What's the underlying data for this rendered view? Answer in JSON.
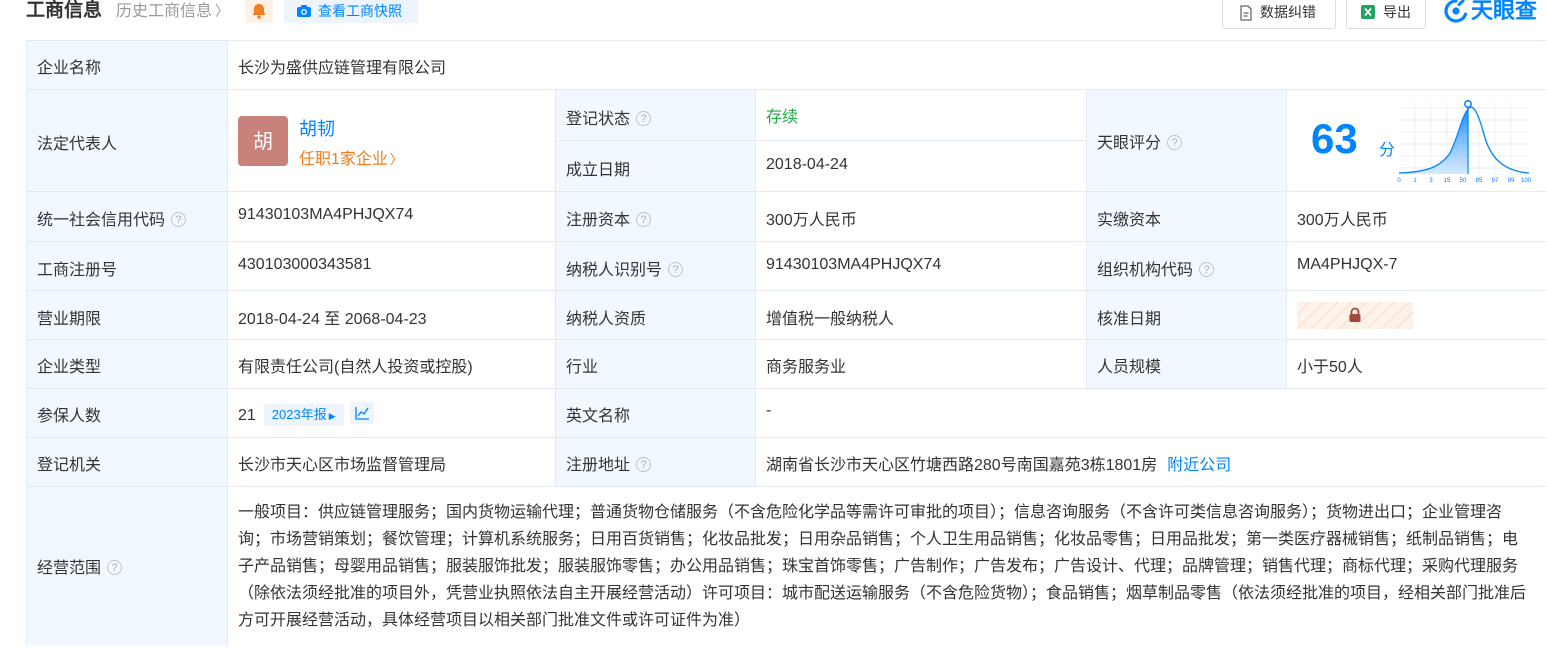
{
  "header": {
    "title": "工商信息",
    "history": "历史工商信息",
    "snapshot": "查看工商快照",
    "fix_btn": "数据纠错",
    "export_btn": "导出",
    "logo": "天眼查"
  },
  "icons": {
    "bell": "bell-icon",
    "camera": "camera-icon",
    "doc": "doc-edit-icon",
    "excel": "excel-icon",
    "help": "question-circle-icon",
    "trend": "trend-chart-icon",
    "lock": "lock-icon"
  },
  "colors": {
    "accent": "#0084ff",
    "status_green": "#22a846",
    "link_orange": "#f27d1f",
    "label_bg": "#f2f8ff"
  },
  "company": {
    "name_label": "企业名称",
    "name": "长沙为盛供应链管理有限公司",
    "rep_label": "法定代表人",
    "rep_avatar": "胡",
    "rep_name": "胡韧",
    "rep_jobs": "任职1家企业",
    "status_label": "登记状态",
    "status": "存续",
    "found_label": "成立日期",
    "found_date": "2018-04-24",
    "score_label": "天眼评分",
    "score": "63",
    "score_unit": "分",
    "credit_label": "统一社会信用代码",
    "credit": "91430103MA4PHJQX74",
    "capital_label": "注册资本",
    "capital": "300万人民币",
    "paid_label": "实缴资本",
    "paid": "300万人民币",
    "reg_no_label": "工商注册号",
    "reg_no": "430103000343581",
    "tax_id_label": "纳税人识别号",
    "tax_id": "91430103MA4PHJQX74",
    "org_code_label": "组织机构代码",
    "org_code": "MA4PHJQX-7",
    "term_label": "营业期限",
    "term": "2018-04-24 至 2068-04-23",
    "tax_qual_label": "纳税人资质",
    "tax_qual": "增值税一般纳税人",
    "approve_label": "核准日期",
    "type_label": "企业类型",
    "type": "有限责任公司(自然人投资或控股)",
    "industry_label": "行业",
    "industry": "商务服务业",
    "staff_label": "人员规模",
    "staff": "小于50人",
    "insured_label": "参保人数",
    "insured": "21",
    "insured_year": "2023年报",
    "en_name_label": "英文名称",
    "en_name": "-",
    "authority_label": "登记机关",
    "authority": "长沙市天心区市场监督管理局",
    "address_label": "注册地址",
    "address": "湖南省长沙市天心区竹塘西路280号南国嘉苑3栋1801房",
    "nearby": "附近公司",
    "scope_label": "经营范围",
    "scope": "一般项目：供应链管理服务；国内货物运输代理；普通货物仓储服务（不含危险化学品等需许可审批的项目）；信息咨询服务（不含许可类信息咨询服务）；货物进出口；企业管理咨询；市场营销策划；餐饮管理；计算机系统服务；日用百货销售；化妆品批发；日用杂品销售；个人卫生用品销售；化妆品零售；日用品批发；第一类医疗器械销售；纸制品销售；电子产品销售；母婴用品销售；服装服饰批发；服装服饰零售；办公用品销售；珠宝首饰零售；广告制作；广告发布；广告设计、代理；品牌管理；销售代理；商标代理；采购代理服务（除依法须经批准的项目外，凭营业执照依法自主开展经营活动）许可项目：城市配送运输服务（不含危险货物）；食品销售；烟草制品零售（依法须经批准的项目，经相关部门批准后方可开展经营活动，具体经营项目以相关部门批准文件或许可证件为准）"
  },
  "score_chart": {
    "ticks": [
      "0",
      "1",
      "3",
      "15",
      "50",
      "85",
      "97",
      "99",
      "100"
    ],
    "marker_percentile": 63
  }
}
